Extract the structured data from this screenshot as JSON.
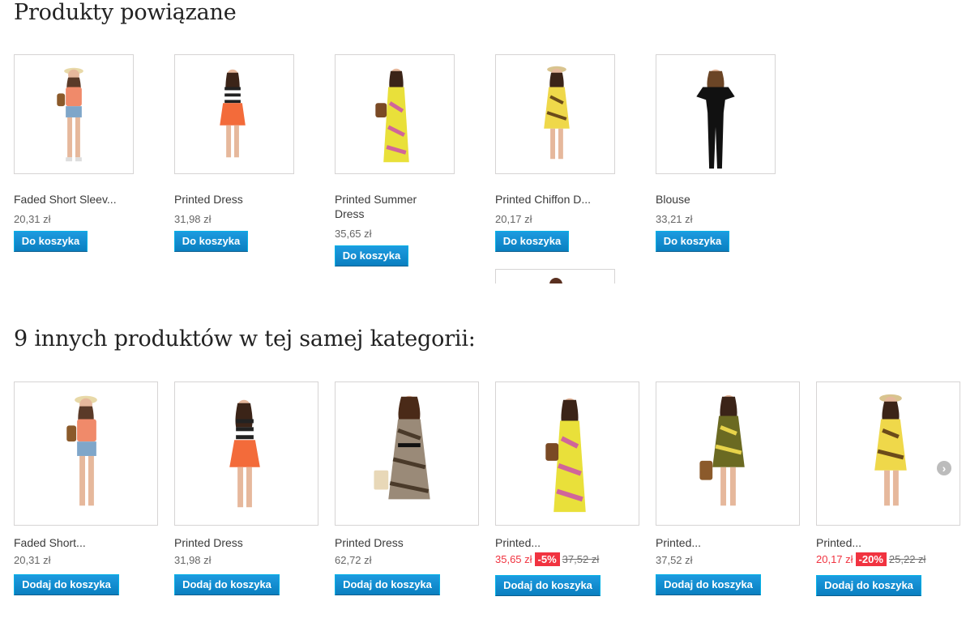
{
  "related": {
    "title": "Produkty powiązane",
    "button_label": "Do koszyka",
    "items": [
      {
        "name": "Faded Short Sleev...",
        "price": "20,31 zł"
      },
      {
        "name": "Printed Dress",
        "price": "31,98 zł"
      },
      {
        "name": "Printed Summer Dress",
        "price": "35,65 zł"
      },
      {
        "name": "Printed Chiffon D...",
        "price": "20,17 zł"
      },
      {
        "name": "Blouse",
        "price": "33,21 zł"
      }
    ]
  },
  "category": {
    "title": "9 innych produktów w tej samej kategorii:",
    "button_label": "Dodaj do koszyka",
    "next_icon": "chevron-right-icon",
    "items": [
      {
        "name": "Faded Short...",
        "price": "20,31 zł"
      },
      {
        "name": "Printed Dress",
        "price": "31,98 zł"
      },
      {
        "name": "Printed Dress",
        "price": "62,72 zł"
      },
      {
        "name": "Printed...",
        "price": "35,65 zł",
        "discount": "-5%",
        "old_price": "37,52 zł"
      },
      {
        "name": "Printed...",
        "price": "37,52 zł"
      },
      {
        "name": "Printed...",
        "price": "20,17 zł",
        "discount": "-20%",
        "old_price": "25,22 zł"
      }
    ]
  },
  "colors": {
    "button": "#0e8ecf",
    "sale_price": "#f13340",
    "discount_badge": "#f13340"
  }
}
